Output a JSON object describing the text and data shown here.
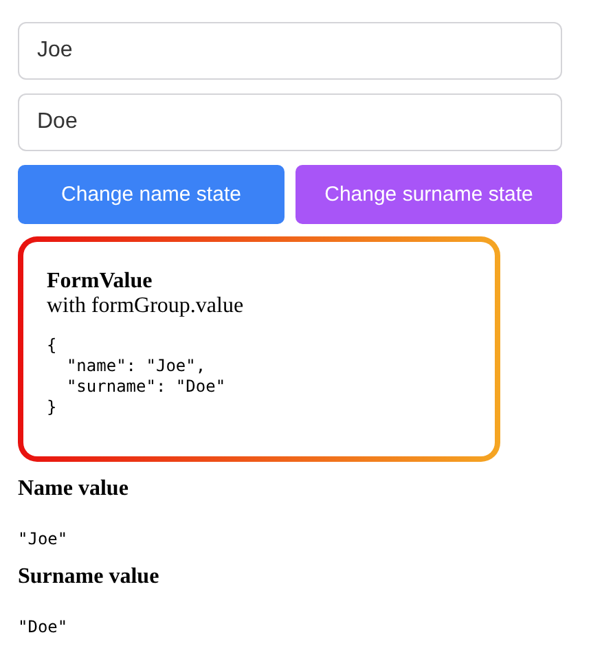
{
  "fields": [
    {
      "value": "Joe"
    },
    {
      "value": "Doe"
    }
  ],
  "buttons": [
    {
      "label": "Change name state",
      "color": "#3b82f6"
    },
    {
      "label": "Change surname state",
      "color": "#a855f7"
    }
  ],
  "form_value_card": {
    "title": "FormValue",
    "subtitle": "with formGroup.value",
    "code": "{\n  \"name\": \"Joe\",\n  \"surname\": \"Doe\"\n}"
  },
  "values": [
    {
      "heading": "Name value",
      "value": "\"Joe\""
    },
    {
      "heading": "Surname value",
      "value": "\"Doe\""
    }
  ]
}
